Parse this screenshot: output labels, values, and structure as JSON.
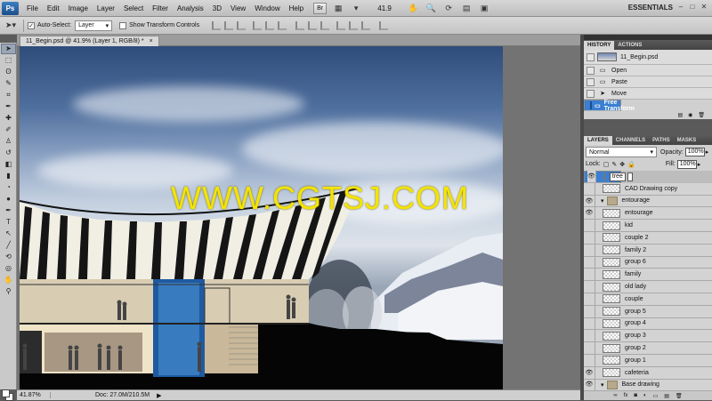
{
  "app": {
    "logo": "Ps",
    "workspace": "ESSENTIALS",
    "zoom_value": "41.9"
  },
  "menu": [
    "File",
    "Edit",
    "Image",
    "Layer",
    "Select",
    "Filter",
    "Analysis",
    "3D",
    "View",
    "Window",
    "Help"
  ],
  "menubar_buttons": {
    "bridge": "Br"
  },
  "options": {
    "auto_select_label": "Auto-Select:",
    "auto_select_value": "Layer",
    "show_transform": "Show Transform Controls"
  },
  "document": {
    "tab_title": "11_Begin.psd @ 41.9% (Layer 1, RGB/8) *",
    "tab_close": "×"
  },
  "watermark": "WWW.CGTSJ.COM",
  "status": {
    "zoom": "41.87%",
    "doc": "Doc: 27.0M/210.5M"
  },
  "history": {
    "tabs": [
      "HISTORY",
      "ACTIONS"
    ],
    "snapshot": "11_Begin.psd",
    "steps": [
      "Open",
      "Paste",
      "Move",
      "Free Transform"
    ],
    "selected_index": 3
  },
  "layers": {
    "tabs": [
      "LAYERS",
      "CHANNELS",
      "PATHS",
      "MASKS"
    ],
    "blend_mode": "Normal",
    "opacity_label": "Opacity:",
    "opacity": "100%",
    "lock_label": "Lock:",
    "fill_label": "Fill:",
    "fill": "100%",
    "rows": [
      {
        "name": "tree",
        "editing": true,
        "visible": true,
        "selected": true
      },
      {
        "name": "CAD Drawing copy",
        "visible": false
      },
      {
        "name": "entourage",
        "group": true,
        "visible": true
      },
      {
        "name": "entourage",
        "visible": true
      },
      {
        "name": "kid",
        "visible": false
      },
      {
        "name": "couple 2",
        "visible": false
      },
      {
        "name": "family 2",
        "visible": false
      },
      {
        "name": "group 6",
        "visible": false
      },
      {
        "name": "family",
        "visible": false
      },
      {
        "name": "old lady",
        "visible": false
      },
      {
        "name": "couple",
        "visible": false
      },
      {
        "name": "group 5",
        "visible": false
      },
      {
        "name": "group 4",
        "visible": false
      },
      {
        "name": "group 3",
        "visible": false
      },
      {
        "name": "group 2",
        "visible": false
      },
      {
        "name": "group 1",
        "visible": false
      },
      {
        "name": "cafeteria",
        "visible": true
      },
      {
        "name": "Base drawing",
        "group": true,
        "visible": true
      }
    ]
  },
  "colors": {
    "selection": "#3a7fd2",
    "watermark": "#f5e400",
    "panel_bg": "#bdbdbd"
  }
}
